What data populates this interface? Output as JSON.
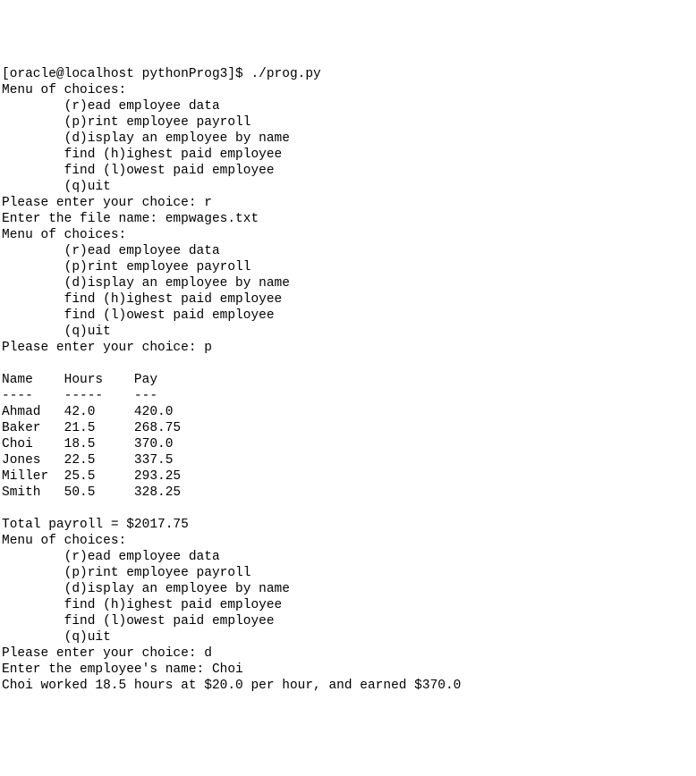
{
  "terminal": {
    "prompt_line": "[oracle@localhost pythonProg3]$ ./prog.py",
    "menu_header": "Menu of choices:",
    "menu_options": {
      "read": "        (r)ead employee data",
      "print": "        (p)rint employee payroll",
      "display": "        (d)isplay an employee by name",
      "highest": "        find (h)ighest paid employee",
      "lowest": "        find (l)owest paid employee",
      "quit": "        (q)uit"
    },
    "choice_prompt": "Please enter your choice: ",
    "choice_r": "r",
    "choice_p": "p",
    "choice_d": "d",
    "file_prompt": "Enter the file name: ",
    "file_name": "empwages.txt",
    "payroll_header": "Name    Hours    Pay",
    "payroll_divider": "----    -----    ---",
    "payroll_rows": [
      "Ahmad   42.0     420.0",
      "Baker   21.5     268.75",
      "Choi    18.5     370.0",
      "Jones   22.5     337.5",
      "Miller  25.5     293.25",
      "Smith   50.5     328.25"
    ],
    "total_line": "Total payroll = $2017.75",
    "emp_name_prompt": "Enter the employee's name: ",
    "emp_name": "Choi",
    "emp_result": "Choi worked 18.5 hours at $20.0 per hour, and earned $370.0"
  }
}
